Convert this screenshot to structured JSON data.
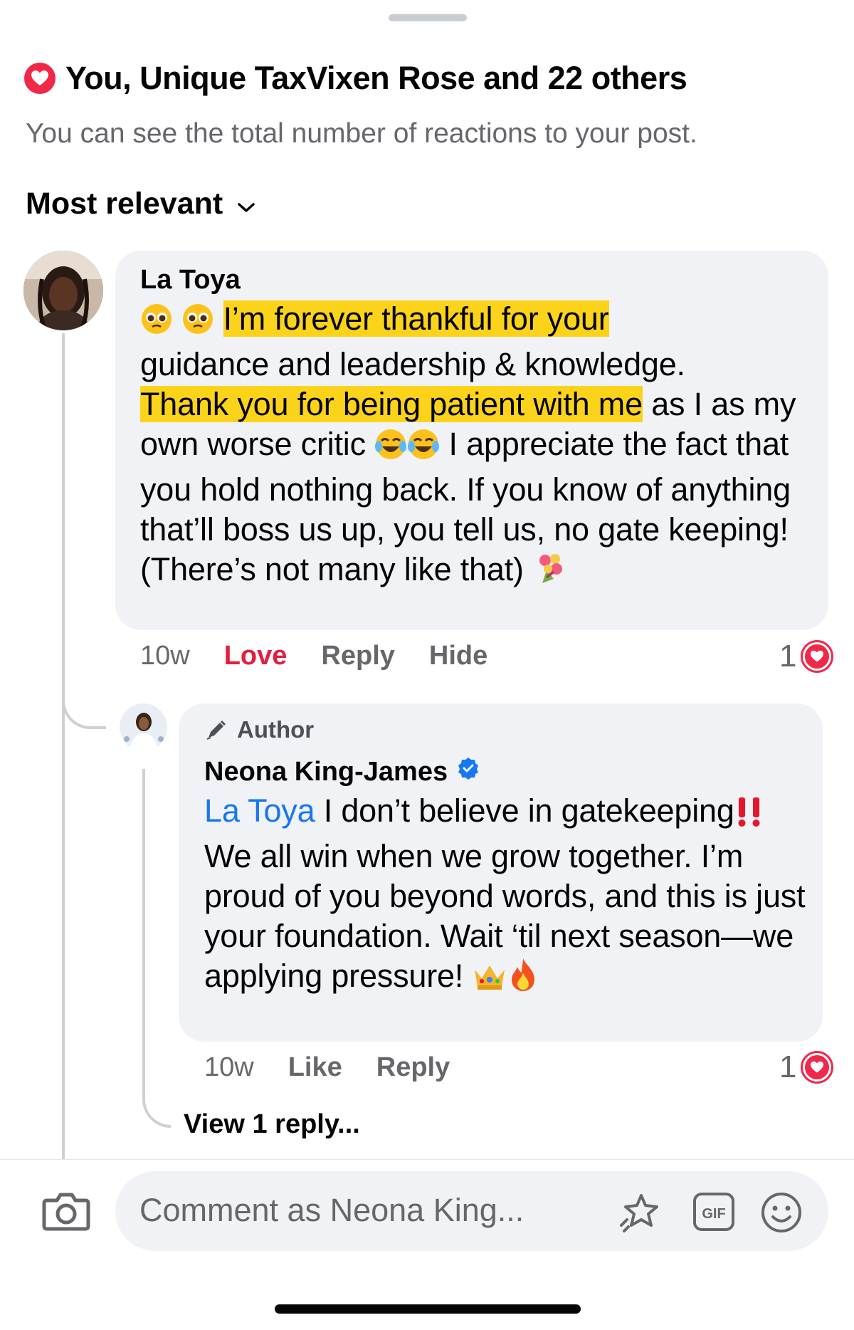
{
  "reactions": {
    "summary": "You, Unique TaxVixen Rose and 22 others",
    "subtitle": "You can see the total number of reactions to your post.",
    "icon": "heart-icon",
    "color": "#f02849"
  },
  "sort": {
    "label": "Most relevant",
    "icon": "chevron-down-icon"
  },
  "comments": [
    {
      "author": "La Toya",
      "text_parts": {
        "highlight_1": "I’m forever thankful for your",
        "plain_1": "guidance and leadership & knowledge.",
        "highlight_2": "Thank you for being patient with me",
        "plain_2": " as I as my own worse critic ",
        "plain_3": " I appreciate the fact that you hold nothing back. If you know of anything that’ll boss us up, you tell us, no gate keeping! (There’s not many like that) "
      },
      "emojis": [
        "pleading-face",
        "pleading-face",
        "tears-of-joy",
        "tears-of-joy",
        "bouquet"
      ],
      "time": "10w",
      "actions": {
        "love": "Love",
        "reply": "Reply",
        "hide": "Hide"
      },
      "reaction_count": "1"
    },
    {
      "author_badge": "Author",
      "author": "Neona King-James",
      "verified": true,
      "mention": "La Toya",
      "text_parts": {
        "plain_1": " I don’t believe in gatekeeping",
        "plain_2": " We all win when we grow together. I’m proud of you beyond words, and this is just your foundation. Wait ‘til next season—we applying pressure! "
      },
      "emojis": [
        "double-exclamation",
        "crown",
        "fire"
      ],
      "time": "10w",
      "actions": {
        "like": "Like",
        "reply": "Reply"
      },
      "reaction_count": "1"
    }
  ],
  "view_replies": "View 1 reply...",
  "composer": {
    "placeholder": "Comment as Neona King...",
    "icons": [
      "camera-icon",
      "sparkle-icon",
      "gif-icon",
      "smile-icon"
    ]
  },
  "colors": {
    "accent_blue": "#1877f2",
    "love_red": "#e41e3f",
    "highlight_yellow": "#fbd31b",
    "bubble_gray": "#f0f2f5",
    "secondary_text": "#65676b"
  }
}
